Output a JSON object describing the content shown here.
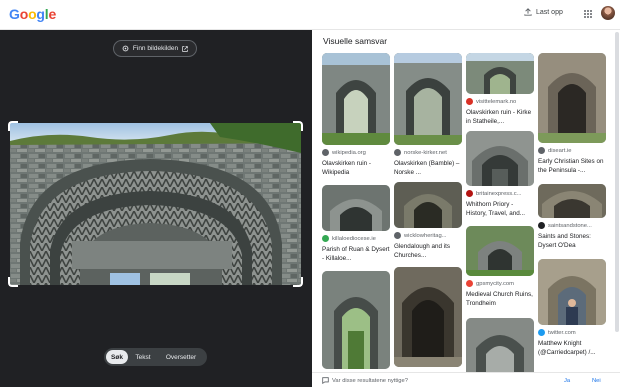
{
  "header": {
    "logo": [
      "G",
      "o",
      "o",
      "g",
      "l",
      "e"
    ],
    "logo_colors": [
      "#4285f4",
      "#ea4335",
      "#fbbc05",
      "#4285f4",
      "#34a853",
      "#ea4335"
    ],
    "upload_label": "Last opp"
  },
  "left": {
    "find_source_label": "Finn bildekilden",
    "modes": [
      "Søk",
      "Tekst",
      "Oversetter"
    ],
    "active_mode": "Søk"
  },
  "results": {
    "title": "Visuelle samsvar",
    "items": [
      {
        "source": "wikipedia.org",
        "title": "Olavskirken ruin - Wikipedia",
        "fav_color": "#5f6368"
      },
      {
        "source": "norske-kirker.net",
        "title": "Olavskirken (Bamble) – Norske ...",
        "fav_color": "#5f6368"
      },
      {
        "source": "visittelemark.no",
        "title": "Olavskirken ruin - Kirke in Statheile,...",
        "fav_color": "#d93025"
      },
      {
        "source": "diseart.ie",
        "title": "Early Christian Sites on the Peninsula -...",
        "fav_color": "#5f6368"
      },
      {
        "source": "britainexpress.c...",
        "title": "Whithorn Priory - History, Travel, and...",
        "fav_color": "#b31412"
      },
      {
        "source": "saintsandstone...",
        "title": "Saints and Stones: Dysert O'Dea",
        "fav_color": "#202124"
      },
      {
        "source": "killaloediocese.ie",
        "title": "Parish of Ruan & Dysert - Killaloe...",
        "fav_color": "#34a853"
      },
      {
        "source": "wicklowheritag...",
        "title": "Glendalough and its Churches...",
        "fav_color": "#5f6368"
      },
      {
        "source": "gpsmycity.com",
        "title": "Medieval Church Ruins, Trondheim",
        "fav_color": "#ea4335"
      },
      {
        "source": "twitter.com",
        "title": "Matthew Knight (@Carriedcarpet) /...",
        "fav_color": "#1d9bf0"
      }
    ]
  },
  "feedback": {
    "question": "Var disse resultatene nyttige?",
    "yes": "Ja",
    "no": "Nei"
  }
}
